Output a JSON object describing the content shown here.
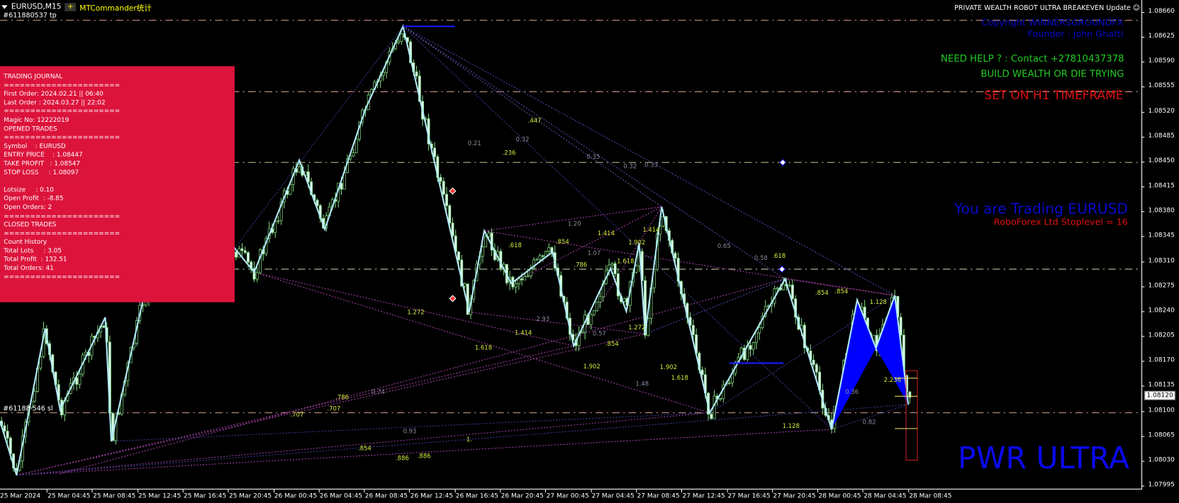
{
  "header": {
    "symbol": "EURUSD,M15",
    "plus_label": "+",
    "plugin": "MTCommander统计"
  },
  "order_labels": {
    "tp": "#611880537 tp",
    "sl": "#61188 546 sl"
  },
  "overlay": {
    "robot_title": "PRIVATE WEALTH ROBOT ULTRA BREAKEVEN Update ☺",
    "copyright": "Copyright WINNERSGROUNDFX",
    "founder": "Founder : john Ghatti",
    "help": "NEED HELP ? : Contact +27810437378",
    "motto": "BUILD WEALTH OR DIE TRYING",
    "timeframe_note": "SET ON H1 TIMEFRAME",
    "trading": "You are Trading EURUSD",
    "stoplevel": "RoboForex Ltd Stoplevel = 16",
    "brand": "PWR ULTRA"
  },
  "journal": {
    "lines": [
      "TRADING JOURNAL",
      "======================",
      "First Order: 2024.02.21 || 06:40",
      "Last Order : 2024.03.27 || 22:02",
      "======================",
      "Magic No: 12222019",
      "OPENED TRADES",
      "======================",
      "Symbol    : EURUSD",
      "ENTRY PRICE    : 1.08447",
      "TAKE PROFIT   : 1.08547",
      "STOP LOSS     : 1.08097",
      " ",
      "Lotsize     : 0.10",
      "Open Profit  : -8.85",
      "Open Orders: 2",
      "======================",
      "CLOSED TRADES",
      "======================",
      "Count History",
      "Total Lots     : 3.05",
      "Total Profit  : 132.51",
      "Total Orders: 41",
      "======================"
    ]
  },
  "price_axis": [
    "1.08660",
    "1.08625",
    "1.08590",
    "1.08555",
    "1.08520",
    "1.08485",
    "1.08450",
    "1.08415",
    "1.08380",
    "1.08345",
    "1.08310",
    "1.08275",
    "1.08240",
    "1.08205",
    "1.08170",
    "1.08135",
    "1.08100",
    "1.08065",
    "1.08030",
    "1.07995"
  ],
  "current_price": "1.08120",
  "time_axis": [
    "25 Mar 2024",
    "25 Mar 04:45",
    "25 Mar 08:45",
    "25 Mar 12:45",
    "25 Mar 16:45",
    "25 Mar 20:45",
    "26 Mar 00:45",
    "26 Mar 04:45",
    "26 Mar 08:45",
    "26 Mar 12:45",
    "26 Mar 16:45",
    "26 Mar 20:45",
    "27 Mar 00:45",
    "27 Mar 04:45",
    "27 Mar 08:45",
    "27 Mar 12:45",
    "27 Mar 16:45",
    "27 Mar 20:45",
    "28 Mar 00:45",
    "28 Mar 04:45",
    "28 Mar 08:45"
  ],
  "fib_labels": [
    ".447",
    "0.21",
    "0.32",
    ".236",
    "0.35",
    "0.32",
    "0.33",
    "1.20",
    "1.414",
    "1.414",
    ".854",
    "1.902",
    ".618",
    "1.07",
    "1.618",
    ".786",
    "0.65",
    "0.58",
    ".618",
    ".854",
    ".854",
    "1.128",
    "1.272",
    "1.414",
    "2.93",
    "0.57",
    "1.272",
    ".854",
    "1.618",
    "1.902",
    "1.902",
    "1.618",
    "1.48",
    "2.236",
    "0.36",
    ".786",
    "0.74",
    ".707",
    ".707",
    "0.82",
    "1.128",
    "0.93",
    "1.",
    ".854",
    ".886",
    ".886"
  ],
  "colors": {
    "journal_bg": "#dc143c",
    "zigzag": "#b0e8f4",
    "pattern_fill": "#0000ff",
    "fib_yellow": "#d4e83a",
    "fib_grey": "#8a8aa0"
  }
}
